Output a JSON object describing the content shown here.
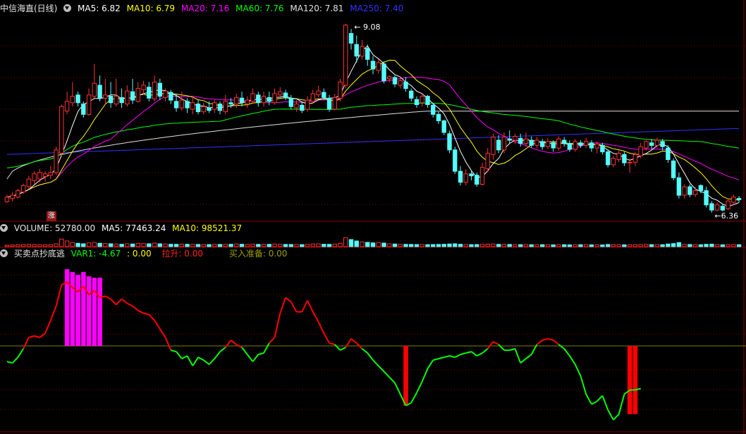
{
  "panel1": {
    "title": "中信海直(日线)",
    "ma5": "MA5: 6.82",
    "ma10": "MA10: 6.79",
    "ma20": "MA20: 7.16",
    "ma60": "MA60: 7.76",
    "ma120": "MA120: 7.81",
    "ma250": "MA250: 7.40",
    "high_label": "9.08",
    "low_label": "6.36",
    "badge": "涨"
  },
  "panel2": {
    "title": "VOLUME: 52780.00",
    "ma5": "MA5: 77463.24",
    "ma10": "MA10: 98521.37"
  },
  "panel3": {
    "title": "买卖点抄底逃",
    "var1": "VAR1: -4.67",
    "v2": ": 0.00",
    "lash": "拉升: 0.00",
    "ready": "买入准备: 0.00"
  },
  "colors": {
    "up": "#ff3232",
    "down": "#54ffff",
    "ma5": "#ffffff",
    "ma10": "#ffff00",
    "ma20": "#ff00ff",
    "ma60": "#00ff00",
    "ma120": "#e0e0e0",
    "ma250": "#3232ff",
    "var_up": "#ff0000",
    "var_down": "#00ff00",
    "bar_magenta": "#ff00ff",
    "bar_red": "#ff0000",
    "grid": "#8b0000"
  },
  "chart_data": {
    "type": "candlestick",
    "price_range": [
      6.2,
      9.25
    ],
    "candles": [
      [
        6.35,
        6.42,
        6.33,
        6.46
      ],
      [
        6.4,
        6.45,
        6.35,
        6.5
      ],
      [
        6.42,
        6.52,
        6.4,
        6.55
      ],
      [
        6.5,
        6.6,
        6.47,
        6.63
      ],
      [
        6.58,
        6.7,
        6.55,
        6.75
      ],
      [
        6.68,
        6.78,
        6.62,
        6.82
      ],
      [
        6.7,
        6.8,
        6.65,
        6.86
      ],
      [
        6.74,
        6.78,
        6.66,
        6.82
      ],
      [
        6.76,
        6.8,
        6.7,
        6.9
      ],
      [
        6.8,
        7.15,
        6.76,
        7.2
      ],
      [
        7.1,
        7.82,
        7.05,
        7.85
      ],
      [
        7.75,
        7.9,
        7.7,
        8.05
      ],
      [
        7.88,
        7.98,
        7.82,
        8.2
      ],
      [
        8.0,
        7.88,
        7.82,
        8.05
      ],
      [
        7.86,
        7.7,
        7.65,
        7.9
      ],
      [
        7.7,
        8.0,
        7.68,
        8.1
      ],
      [
        7.98,
        8.18,
        7.95,
        8.48
      ],
      [
        8.15,
        7.95,
        7.9,
        8.3
      ],
      [
        7.95,
        8.0,
        7.85,
        8.25
      ],
      [
        7.98,
        7.88,
        7.8,
        8.2
      ],
      [
        7.86,
        7.98,
        7.82,
        8.25
      ],
      [
        7.96,
        7.88,
        7.8,
        8.1
      ],
      [
        7.86,
        8.06,
        7.82,
        8.15
      ],
      [
        8.05,
        7.92,
        7.86,
        8.25
      ],
      [
        7.9,
        8.1,
        7.88,
        8.2
      ],
      [
        8.08,
        8.15,
        8.0,
        8.22
      ],
      [
        8.12,
        7.95,
        7.9,
        8.2
      ],
      [
        7.94,
        8.2,
        7.9,
        8.3
      ],
      [
        8.18,
        7.98,
        7.92,
        8.25
      ],
      [
        7.96,
        8.06,
        7.9,
        8.1
      ],
      [
        8.04,
        7.92,
        7.86,
        8.08
      ],
      [
        7.9,
        7.8,
        7.74,
        8.02
      ],
      [
        7.8,
        7.92,
        7.76,
        8.05
      ],
      [
        7.9,
        7.8,
        7.72,
        7.95
      ],
      [
        7.78,
        7.88,
        7.7,
        7.98
      ],
      [
        7.86,
        7.74,
        7.7,
        7.92
      ],
      [
        7.74,
        7.82,
        7.7,
        7.88
      ],
      [
        7.8,
        7.76,
        7.72,
        7.9
      ],
      [
        7.78,
        7.88,
        7.72,
        7.92
      ],
      [
        7.86,
        7.76,
        7.7,
        7.9
      ],
      [
        7.74,
        7.9,
        7.7,
        8.0
      ],
      [
        7.88,
        7.86,
        7.8,
        7.95
      ],
      [
        7.86,
        7.96,
        7.8,
        8.02
      ],
      [
        7.95,
        7.88,
        7.82,
        8.05
      ],
      [
        7.86,
        7.92,
        7.8,
        7.98
      ],
      [
        7.9,
        8.02,
        7.86,
        8.1
      ],
      [
        8.0,
        7.88,
        7.82,
        8.05
      ],
      [
        7.88,
        7.98,
        7.82,
        8.05
      ],
      [
        7.96,
        7.9,
        7.84,
        8.05
      ],
      [
        7.88,
        8.02,
        7.85,
        8.1
      ],
      [
        8.0,
        8.05,
        7.95,
        8.12
      ],
      [
        8.03,
        7.96,
        7.92,
        8.08
      ],
      [
        7.95,
        7.82,
        7.78,
        8.0
      ],
      [
        7.8,
        7.86,
        7.74,
        7.92
      ],
      [
        7.84,
        7.76,
        7.72,
        7.9
      ],
      [
        7.78,
        7.92,
        7.74,
        7.98
      ],
      [
        7.9,
        8.02,
        7.86,
        8.08
      ],
      [
        8.0,
        8.06,
        7.96,
        8.14
      ],
      [
        8.04,
        7.96,
        7.92,
        8.1
      ],
      [
        7.95,
        7.78,
        7.74,
        8.0
      ],
      [
        7.78,
        7.96,
        7.76,
        8.02
      ],
      [
        7.95,
        8.2,
        7.9,
        8.25
      ],
      [
        8.15,
        9.08,
        8.1,
        9.1
      ],
      [
        8.95,
        8.8,
        8.7,
        9.02
      ],
      [
        8.78,
        8.6,
        8.5,
        8.92
      ],
      [
        8.6,
        8.75,
        8.55,
        8.85
      ],
      [
        8.72,
        8.55,
        8.45,
        8.78
      ],
      [
        8.52,
        8.4,
        8.32,
        8.6
      ],
      [
        8.38,
        8.5,
        8.33,
        8.55
      ],
      [
        8.48,
        8.22,
        8.18,
        8.52
      ],
      [
        8.25,
        8.28,
        8.2,
        8.3
      ],
      [
        8.27,
        8.17,
        8.12,
        8.3
      ],
      [
        8.15,
        8.22,
        8.1,
        8.28
      ],
      [
        8.2,
        8.1,
        8.05,
        8.28
      ],
      [
        8.06,
        7.95,
        7.9,
        8.1
      ],
      [
        7.93,
        7.85,
        7.8,
        7.98
      ],
      [
        7.88,
        7.98,
        7.82,
        8.02
      ],
      [
        7.98,
        7.85,
        7.8,
        8.0
      ],
      [
        7.84,
        7.7,
        7.65,
        7.88
      ],
      [
        7.7,
        7.6,
        7.55,
        7.74
      ],
      [
        7.6,
        7.42,
        7.38,
        7.62
      ],
      [
        7.4,
        7.15,
        7.1,
        7.45
      ],
      [
        7.15,
        6.82,
        6.78,
        7.2
      ],
      [
        6.82,
        6.65,
        6.6,
        6.9
      ],
      [
        6.65,
        6.78,
        6.6,
        6.85
      ],
      [
        6.78,
        6.75,
        6.68,
        6.82
      ],
      [
        6.76,
        6.62,
        6.58,
        6.8
      ],
      [
        6.62,
        6.88,
        6.6,
        6.95
      ],
      [
        6.86,
        7.1,
        6.82,
        7.18
      ],
      [
        7.08,
        7.35,
        7.0,
        7.4
      ],
      [
        7.3,
        7.15,
        7.1,
        7.38
      ],
      [
        7.15,
        7.35,
        7.1,
        7.42
      ],
      [
        7.32,
        7.3,
        7.25,
        7.45
      ],
      [
        7.3,
        7.36,
        7.24,
        7.4
      ],
      [
        7.33,
        7.25,
        7.2,
        7.4
      ],
      [
        7.25,
        7.32,
        7.2,
        7.42
      ],
      [
        7.3,
        7.22,
        7.18,
        7.36
      ],
      [
        7.22,
        7.3,
        7.18,
        7.35
      ],
      [
        7.28,
        7.2,
        7.15,
        7.32
      ],
      [
        7.2,
        7.28,
        7.16,
        7.33
      ],
      [
        7.26,
        7.18,
        7.12,
        7.3
      ],
      [
        7.18,
        7.32,
        7.14,
        7.36
      ],
      [
        7.3,
        7.25,
        7.2,
        7.35
      ],
      [
        7.25,
        7.16,
        7.12,
        7.3
      ],
      [
        7.16,
        7.28,
        7.12,
        7.32
      ],
      [
        7.26,
        7.22,
        7.18,
        7.3
      ],
      [
        7.22,
        7.28,
        7.18,
        7.34
      ],
      [
        7.26,
        7.18,
        7.12,
        7.3
      ],
      [
        7.18,
        7.24,
        7.1,
        7.28
      ],
      [
        7.22,
        7.12,
        7.08,
        7.26
      ],
      [
        7.12,
        6.92,
        6.88,
        7.16
      ],
      [
        6.92,
        7.02,
        6.88,
        7.06
      ],
      [
        7.0,
        7.1,
        6.96,
        7.14
      ],
      [
        7.08,
        6.95,
        6.9,
        7.12
      ],
      [
        6.95,
        6.96,
        6.8,
        7.02
      ],
      [
        6.96,
        7.08,
        6.9,
        7.12
      ],
      [
        7.06,
        7.2,
        7.02,
        7.26
      ],
      [
        7.18,
        7.28,
        7.14,
        7.3
      ],
      [
        7.26,
        7.22,
        7.16,
        7.32
      ],
      [
        7.22,
        7.3,
        7.18,
        7.34
      ],
      [
        7.28,
        7.2,
        7.14,
        7.32
      ],
      [
        7.18,
        7.0,
        6.95,
        7.22
      ],
      [
        6.98,
        6.72,
        6.68,
        7.02
      ],
      [
        6.72,
        6.45,
        6.4,
        6.8
      ],
      [
        6.45,
        6.58,
        6.4,
        6.62
      ],
      [
        6.58,
        6.46,
        6.42,
        6.62
      ],
      [
        6.46,
        6.52,
        6.42,
        6.58
      ],
      [
        6.6,
        6.52,
        6.48,
        6.62
      ],
      [
        6.52,
        6.3,
        6.26,
        6.58
      ],
      [
        6.32,
        6.22,
        6.18,
        6.36
      ],
      [
        6.22,
        6.3,
        6.2,
        6.34
      ],
      [
        6.28,
        6.22,
        6.2,
        6.32
      ],
      [
        6.24,
        6.36,
        6.22,
        6.4
      ],
      [
        6.34,
        6.42,
        6.3,
        6.46
      ],
      [
        6.4,
        6.38,
        6.34,
        6.44
      ]
    ],
    "volume": {
      "range": [
        0,
        300000
      ],
      "values": [
        30,
        35,
        40,
        45,
        50,
        45,
        40,
        38,
        42,
        60,
        160,
        120,
        90,
        70,
        60,
        80,
        90,
        70,
        65,
        60,
        55,
        50,
        60,
        55,
        70,
        65,
        60,
        75,
        60,
        55,
        50,
        48,
        52,
        50,
        48,
        46,
        45,
        44,
        50,
        46,
        48,
        50,
        55,
        50,
        46,
        52,
        48,
        50,
        48,
        55,
        50,
        46,
        45,
        44,
        42,
        48,
        55,
        58,
        50,
        48,
        52,
        70,
        190,
        150,
        120,
        100,
        90,
        80,
        85,
        75,
        60,
        55,
        50,
        48,
        46,
        44,
        45,
        42,
        44,
        46,
        50,
        55,
        60,
        50,
        45,
        42,
        44,
        48,
        52,
        55,
        48,
        50,
        46,
        44,
        42,
        45,
        40,
        42,
        40,
        42,
        38,
        44,
        40,
        38,
        42,
        40,
        42,
        38,
        40,
        36,
        45,
        40,
        42,
        38,
        40,
        42,
        45,
        48,
        42,
        44,
        40,
        55,
        65,
        85,
        50,
        45,
        42,
        40,
        48,
        52,
        40,
        38,
        42,
        45,
        40
      ]
    },
    "var1": {
      "baseline": 0,
      "range": [
        -6,
        6
      ],
      "values": [
        -1.1,
        -1.2,
        -0.8,
        -0.2,
        0.6,
        0.7,
        0.6,
        0.9,
        1.8,
        2.8,
        4.3,
        4.5,
        4.1,
        3.8,
        4.2,
        3.6,
        3.9,
        3.4,
        3.5,
        3.3,
        2.9,
        3.3,
        3.0,
        2.8,
        2.5,
        2.3,
        2.2,
        1.8,
        1.2,
        0.6,
        -0.3,
        -0.4,
        -0.9,
        -0.7,
        -1.4,
        -0.8,
        -1.0,
        -1.3,
        -0.9,
        -0.4,
        -0.1,
        0.4,
        0.1,
        -0.1,
        -0.6,
        -1.1,
        -0.6,
        -0.5,
        0.2,
        0.6,
        2.3,
        3.4,
        3.1,
        2.4,
        2.4,
        3.2,
        2.4,
        1.7,
        0.9,
        0.2,
        0.1,
        -0.3,
        -0.1,
        0.5,
        0.2,
        -0.2,
        -0.5,
        -1.0,
        -1.4,
        -1.8,
        -2.2,
        -2.6,
        -3.4,
        -4.2,
        -4.0,
        -3.3,
        -2.5,
        -1.6,
        -1.0,
        -0.9,
        -0.8,
        -0.7,
        -0.8,
        -0.6,
        -0.5,
        -0.4,
        -0.7,
        -0.5,
        -0.2,
        0.3,
        0.1,
        -0.3,
        -0.3,
        -0.2,
        -1.2,
        -0.9,
        -0.6,
        0.1,
        0.4,
        0.5,
        0.4,
        0.1,
        -0.2,
        -0.7,
        -1.3,
        -2.1,
        -3.4,
        -4.1,
        -3.9,
        -3.5,
        -4.5,
        -5.2,
        -4.8,
        -3.4,
        -3.1,
        -3.1,
        -3.0
      ]
    },
    "magenta_bars": [
      [
        11,
        5.4
      ],
      [
        12,
        5.2
      ],
      [
        13,
        5.0
      ],
      [
        14,
        5.2
      ],
      [
        15,
        4.9
      ],
      [
        16,
        4.8
      ],
      [
        17,
        4.8
      ]
    ],
    "red_bars": [
      [
        73,
        -4.2
      ],
      [
        114,
        -4.8
      ],
      [
        115,
        -4.8
      ]
    ]
  }
}
